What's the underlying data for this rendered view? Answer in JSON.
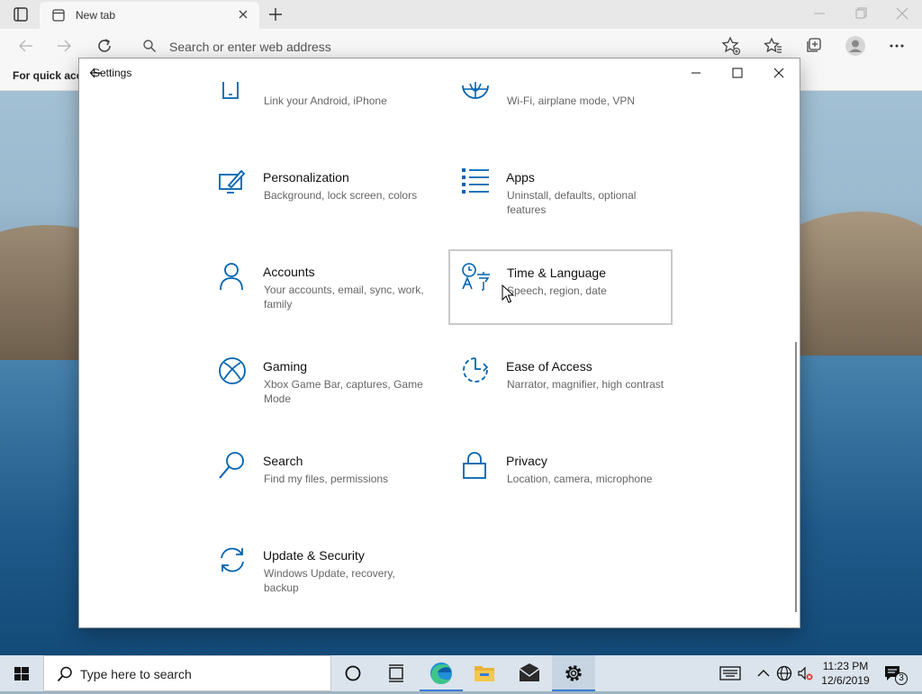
{
  "browser": {
    "tab_title": "New tab",
    "address_placeholder": "Search or enter web address",
    "favorites_bar_text": "For quick acce"
  },
  "settings": {
    "window_title": "Settings",
    "partial_items": [
      {
        "icon": "phone-icon",
        "description": "Link your Android, iPhone"
      },
      {
        "icon": "globe-icon",
        "description": "Wi-Fi, airplane mode, VPN"
      }
    ],
    "items": [
      {
        "id": "personalization",
        "icon": "personalization-icon",
        "name": "Personalization",
        "description": "Background, lock screen, colors"
      },
      {
        "id": "apps",
        "icon": "apps-icon",
        "name": "Apps",
        "description": "Uninstall, defaults, optional features"
      },
      {
        "id": "accounts",
        "icon": "person-icon",
        "name": "Accounts",
        "description": "Your accounts, email, sync, work, family"
      },
      {
        "id": "time-language",
        "icon": "time-language-icon",
        "name": "Time & Language",
        "description": "Speech, region, date",
        "selected": true
      },
      {
        "id": "gaming",
        "icon": "xbox-icon",
        "name": "Gaming",
        "description": "Xbox Game Bar, captures, Game Mode"
      },
      {
        "id": "ease-of-access",
        "icon": "ease-of-access-icon",
        "name": "Ease of Access",
        "description": "Narrator, magnifier, high contrast"
      },
      {
        "id": "search",
        "icon": "search-icon",
        "name": "Search",
        "description": "Find my files, permissions"
      },
      {
        "id": "privacy",
        "icon": "lock-icon",
        "name": "Privacy",
        "description": "Location, camera, microphone"
      },
      {
        "id": "update-security",
        "icon": "update-icon",
        "name": "Update & Security",
        "description": "Windows Update, recovery, backup"
      }
    ],
    "accent_color": "#0063b1"
  },
  "taskbar": {
    "search_placeholder": "Type here to search",
    "time": "11:23 PM",
    "date": "12/6/2019",
    "notification_count": "3"
  }
}
